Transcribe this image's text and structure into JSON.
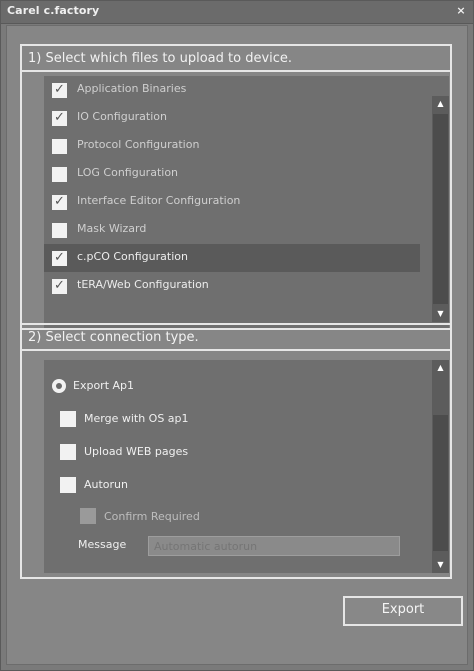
{
  "window": {
    "title": "Carel c.factory",
    "close_glyph": "×"
  },
  "files_section": {
    "title": "1) Select which files to upload to device.",
    "items": [
      {
        "label": "Application Binaries",
        "checked": true
      },
      {
        "label": "IO Configuration",
        "checked": true
      },
      {
        "label": "Protocol Configuration",
        "checked": false
      },
      {
        "label": "LOG Configuration",
        "checked": false
      },
      {
        "label": "Interface Editor Configuration",
        "checked": true
      },
      {
        "label": "Mask Wizard",
        "checked": false
      },
      {
        "label": "c.pCO Configuration",
        "checked": true,
        "selected": true
      },
      {
        "label": "tERA/Web Configuration",
        "checked": true
      }
    ],
    "check_glyph": "✓"
  },
  "connection_section": {
    "title": "2) Select connection type.",
    "export_ap1_label": "Export Ap1",
    "merge_label": "Merge with OS ap1",
    "upload_web_label": "Upload WEB pages",
    "autorun_label": "Autorun",
    "confirm_label": "Confirm Required",
    "message_label": "Message",
    "message_placeholder": "Automatic autorun"
  },
  "scroll_glyphs": {
    "up": "▲",
    "down": "▼"
  },
  "export_button_label": "Export"
}
